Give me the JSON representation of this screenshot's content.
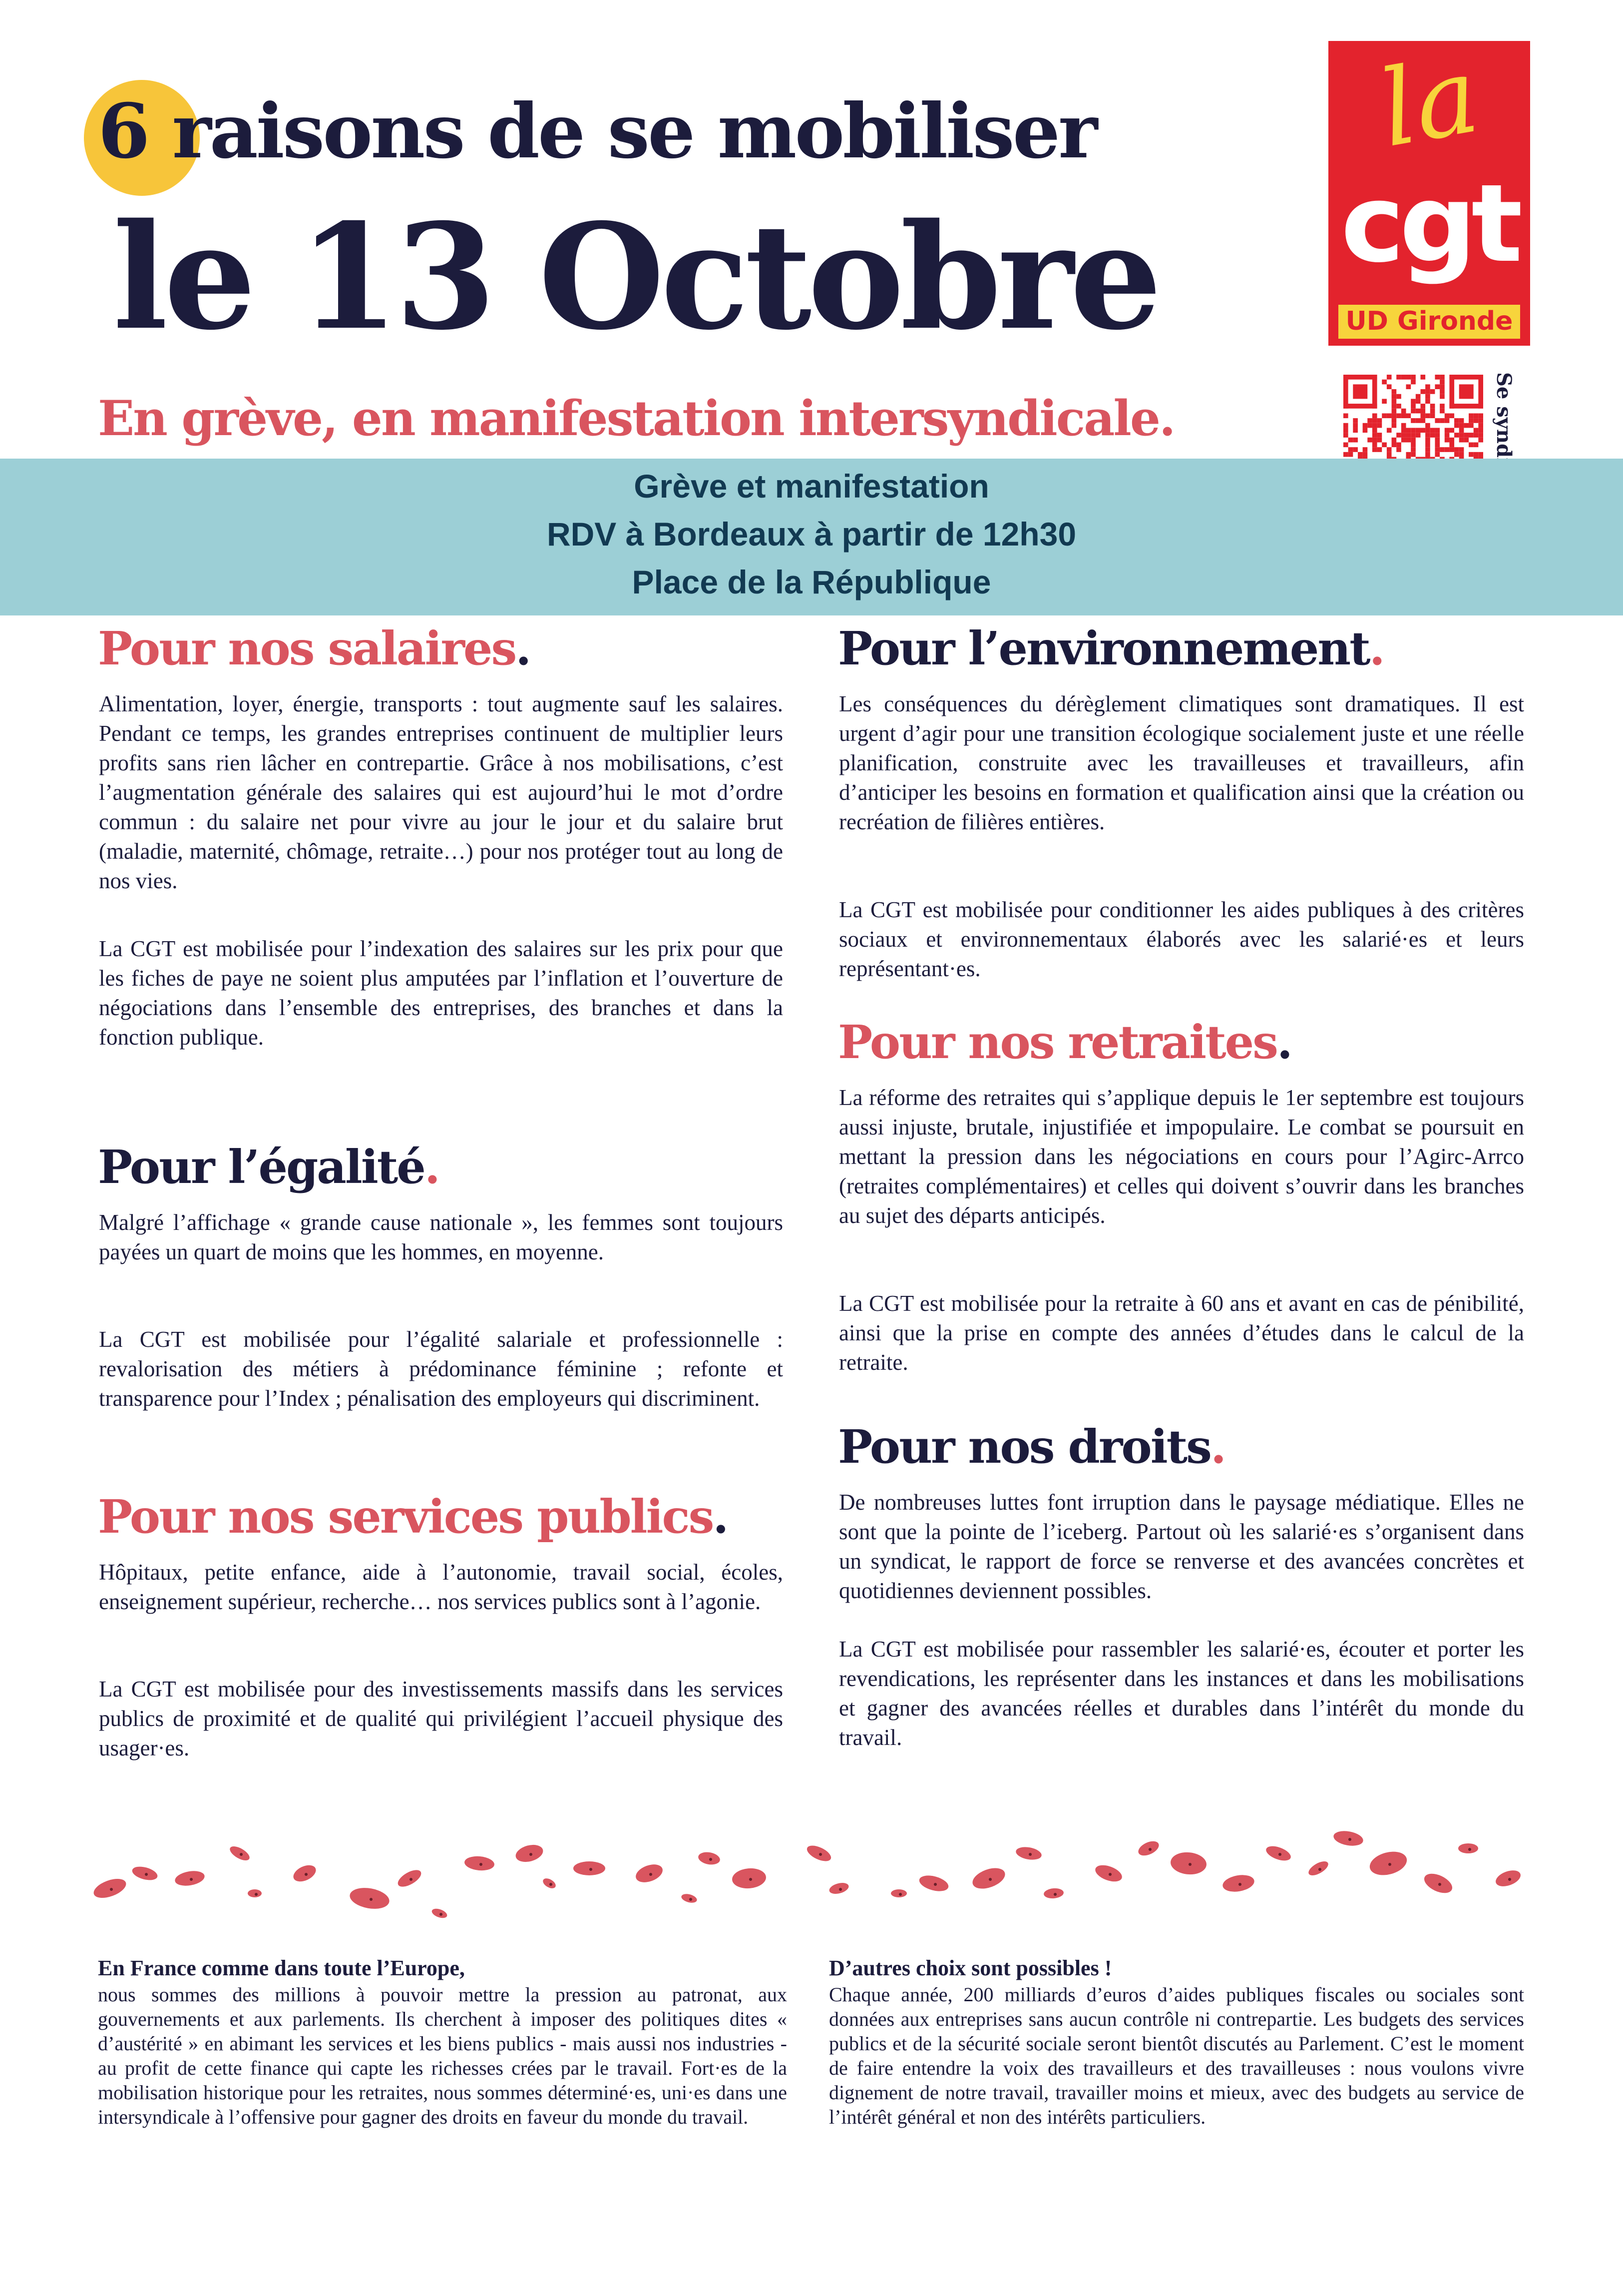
{
  "header": {
    "title_line1": "6 raisons de se mobiliser",
    "title_line2": "le 13 Octobre",
    "subtitle": "En grève, en manifestation intersyndicale."
  },
  "logo": {
    "la": "la",
    "cgt": "cgt",
    "ud": "UD Gironde"
  },
  "qr": {
    "label": "Se syndiquer :"
  },
  "banner": {
    "line1": "Grève et manifestation",
    "line2": "RDV à Bordeaux à partir de 12h30",
    "line3": "Place de la République"
  },
  "sections": {
    "salaires": {
      "title": "Pour nos salaires",
      "dot": ".",
      "p1": "Alimentation, loyer, énergie, transports : tout augmente sauf les salaires. Pendant ce temps, les grandes entreprises continuent de multiplier leurs profits sans rien lâcher en contrepartie. Grâce à nos mobilisations, c’est l’augmentation générale des salaires qui est aujourd’hui le mot d’ordre commun : du salaire net pour vivre au jour le jour et du salaire brut (maladie, maternité, chômage, retraite…) pour nos protéger tout au long de nos vies.",
      "p2": "La CGT est mobilisée pour l’indexation des salaires sur les prix pour que les fiches de paye ne soient plus amputées par l’inflation et l’ouverture de négociations dans l’ensemble des entreprises, des branches et dans la fonction publique."
    },
    "egalite": {
      "title": "Pour l’égalité",
      "dot": ".",
      "p1": "Malgré l’affichage « grande cause nationale », les femmes sont toujours payées un quart de moins que les hommes, en moyenne.",
      "p2": "La CGT est mobilisée pour l’égalité salariale et professionnelle : revalorisation des métiers à prédominance féminine ; refonte et transparence pour l’Index ; pénalisation des employeurs qui discriminent."
    },
    "services": {
      "title": "Pour nos services publics",
      "dot": ".",
      "p1": "Hôpitaux, petite enfance, aide à l’autonomie, travail social, écoles, enseignement supérieur, recherche… nos services publics sont à l’agonie.",
      "p2": "La CGT est mobilisée pour des investissements massifs dans les services publics de proximité et de qualité qui privilégient l’accueil physique des usager·es."
    },
    "environnement": {
      "title": "Pour l’environnement",
      "dot": ".",
      "p1": "Les conséquences du dérèglement climatiques sont dramatiques. Il est urgent d’agir pour une transition écologique socialement juste et une réelle planification, construite avec les travailleuses et travailleurs, afin d’anticiper les besoins en formation et qualification ainsi que la création ou recréation de filières entières.",
      "p2": "La CGT est mobilisée pour conditionner les aides publiques à des critères sociaux et environnementaux élaborés avec les salarié·es et leurs représentant·es."
    },
    "retraites": {
      "title": "Pour nos retraites",
      "dot": ".",
      "p1": "La réforme des retraites qui s’applique depuis le 1er septembre est toujours aussi injuste, brutale, injustifiée et impopulaire. Le combat se poursuit en mettant la pression dans les négociations en cours pour l’Agirc-Arrco (retraites complémentaires) et celles qui doivent s’ouvrir dans les branches au sujet des départs anticipés.",
      "p2": "La CGT est mobilisée pour la retraite à 60 ans et avant en cas de pénibilité, ainsi que la prise en compte des années d’études dans le calcul de la retraite."
    },
    "droits": {
      "title": "Pour nos droits",
      "dot": ".",
      "p1": "De nombreuses luttes font irruption dans le paysage médiatique. Elles ne sont que la pointe de l’iceberg. Partout où les salarié·es s’organisent dans un syndicat, le rapport de force se renverse et des avancées concrètes et quotidiennes deviennent possibles.",
      "p2": "La CGT est mobilisée pour rassembler les salarié·es, écouter et porter les revendications, les représenter dans les instances et dans les mobilisations et gagner des avancées réelles et durables dans l’intérêt du monde du travail."
    }
  },
  "bottom": {
    "left_title": "En France comme dans toute l’Europe,",
    "left_text": "nous sommes des millions à pouvoir mettre la pression au patronat, aux gouvernements et aux parlements. Ils cherchent à imposer des politiques dites « d’austérité » en abimant les services et les biens publics - mais aussi nos industries - au profit de cette finance qui capte les richesses crées par le travail. Fort·es de la mobilisation historique pour les retraites, nous sommes déterminé·es, uni·es dans une intersyndicale à l’offensive pour gagner des droits en faveur du monde du travail.",
    "right_title": "D’autres choix sont possibles !",
    "right_text": "Chaque année, 200 milliards d’euros d’aides publiques fiscales ou sociales sont données aux entreprises sans aucun contrôle ni contrepartie. Les budgets des services publics et de la sécurité sociale seront bientôt discutés au Parlement. C’est le moment de faire entendre la voix des travailleurs et des travailleuses : nous voulons vivre dignement de notre travail, travailler moins et mieux, avec des budgets au service de l’intérêt général et non des intérêts particuliers."
  },
  "colors": {
    "navy": "#1c1c3c",
    "pink": "#d9555f",
    "yellow": "#f7c53a",
    "banner": "#9ccfd6",
    "cgt_red": "#e3232d"
  },
  "icons": {
    "logo": "cgt-logo",
    "qr": "qr-code-icon",
    "decoration": "poppy-petals-decoration"
  }
}
